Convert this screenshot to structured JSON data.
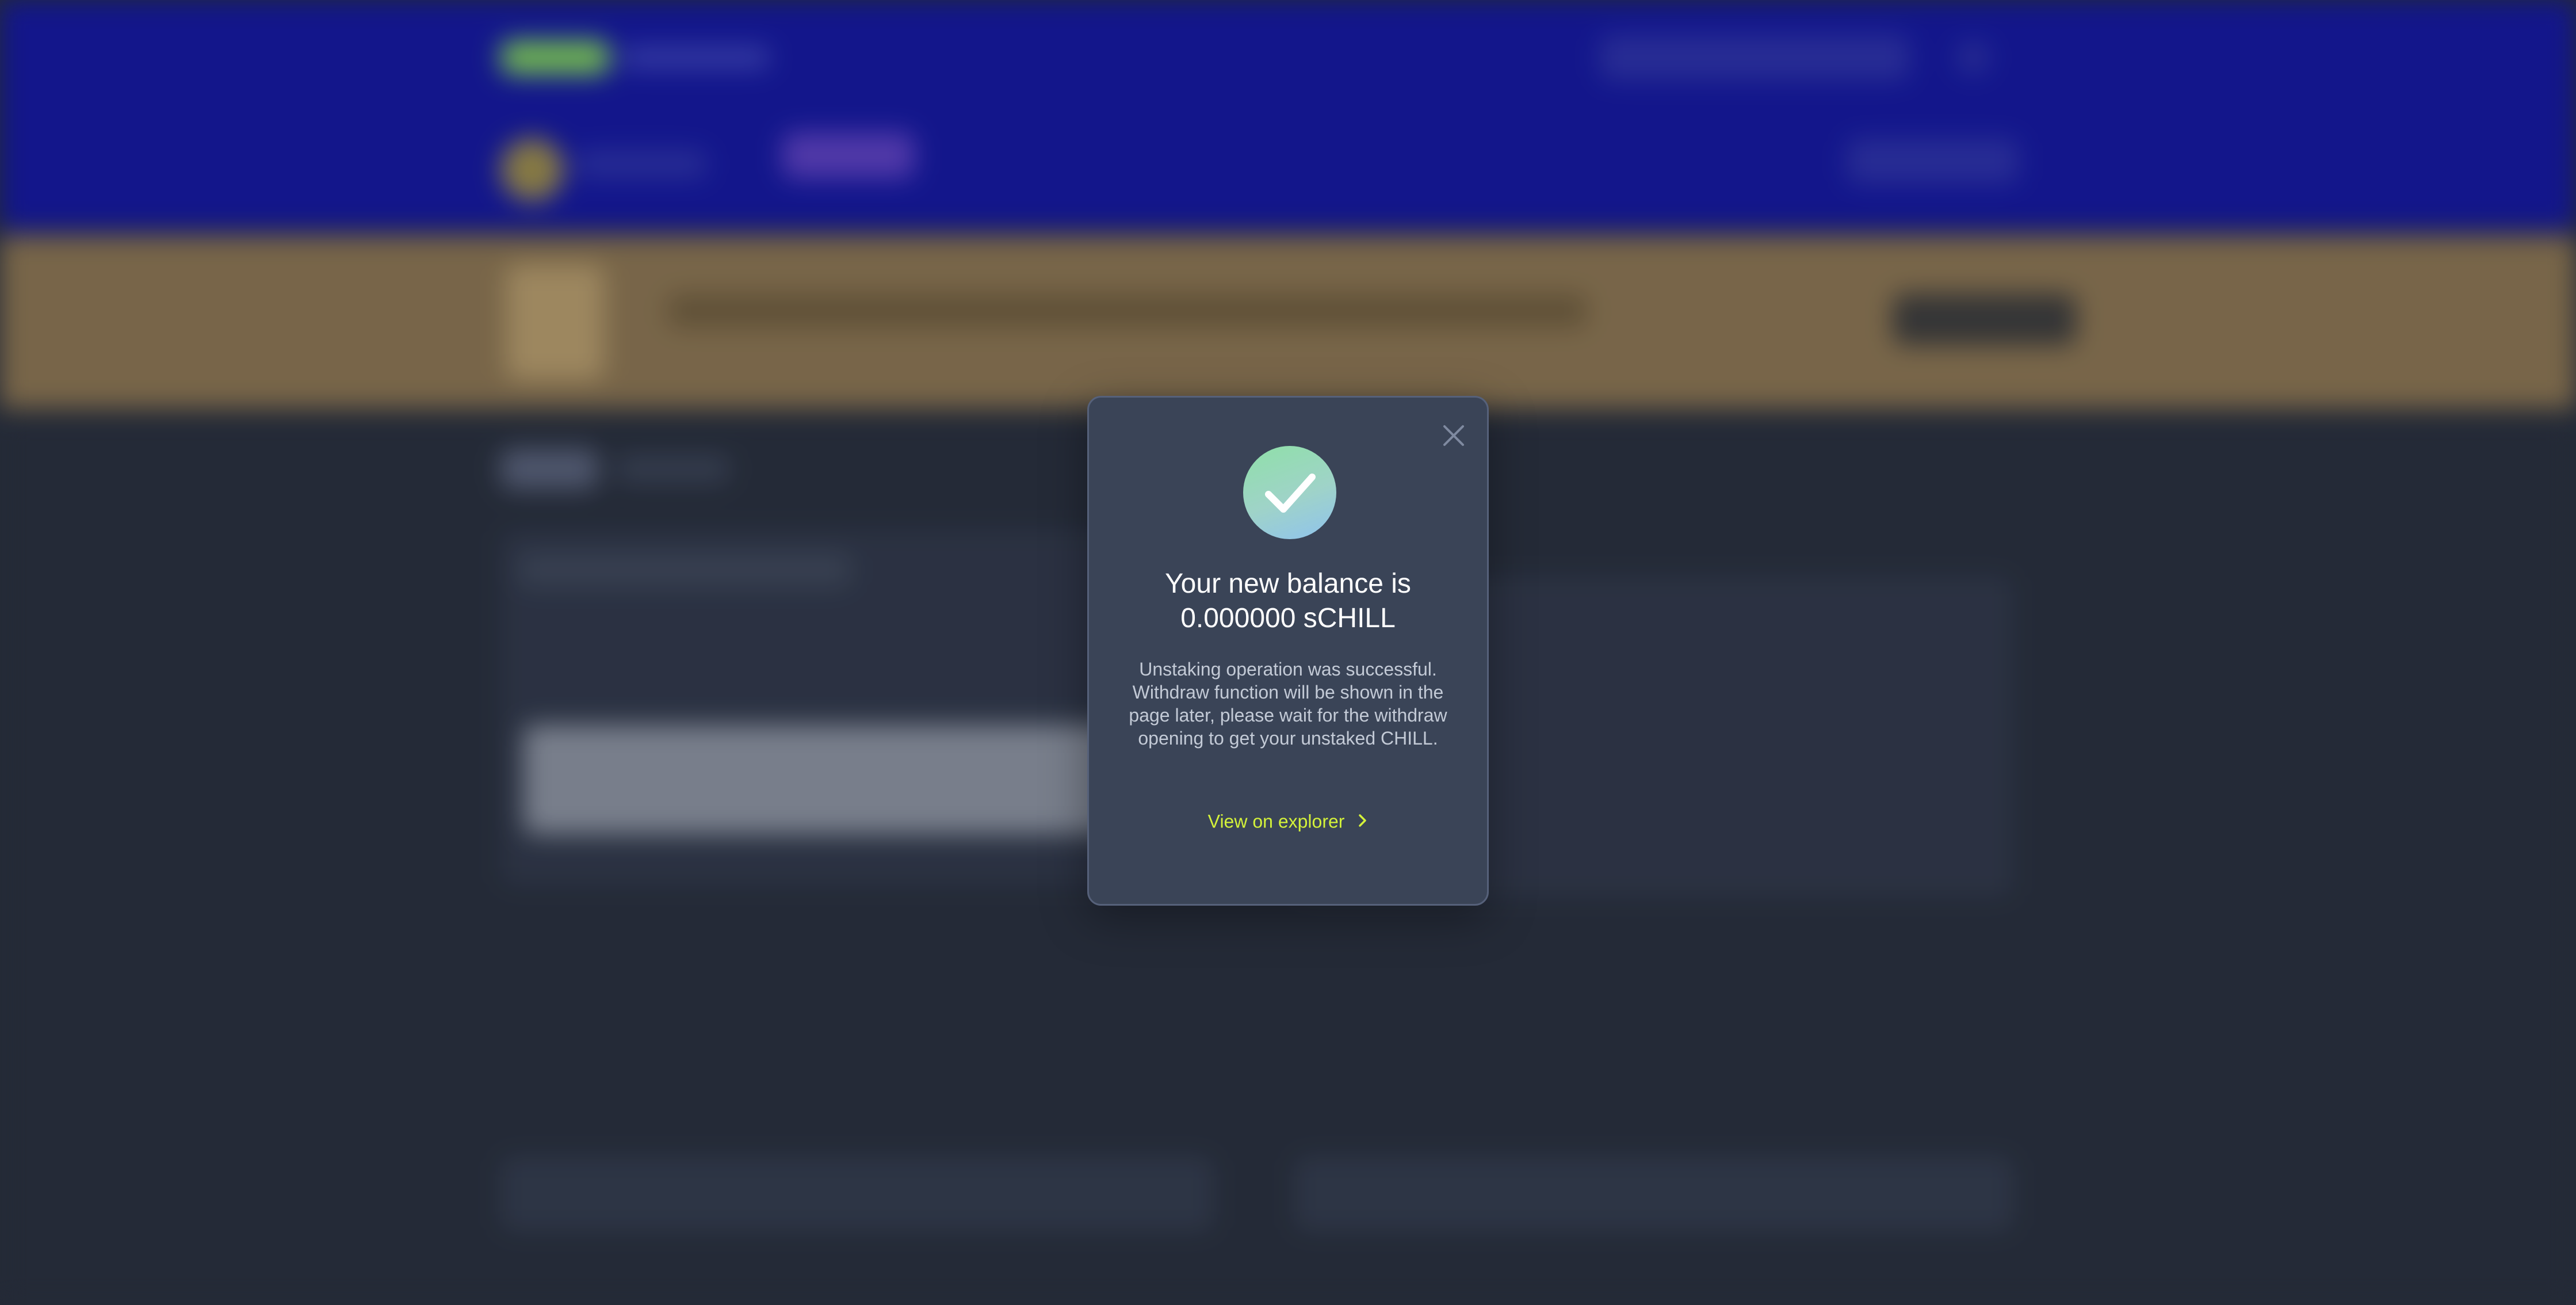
{
  "modal": {
    "title_line1": "Your new balance is",
    "title_line2": "0.000000 sCHILL",
    "description": "Unstaking operation was successful. Withdraw function will be shown in the page later, please wait for the withdraw opening to get your unstaked CHILL.",
    "explorer_link": "View on explorer",
    "icons": {
      "success": "check-icon",
      "close": "close-icon",
      "link": "chevron-right-icon"
    }
  },
  "colors": {
    "header_bg": "#13169e",
    "banner_bg": "#8a7350",
    "page_bg": "#272d3b",
    "modal_bg": "#3a4457",
    "link_accent": "#d4f23a",
    "success_gradient": [
      "#8fe0a8",
      "#8fc3ee"
    ]
  }
}
